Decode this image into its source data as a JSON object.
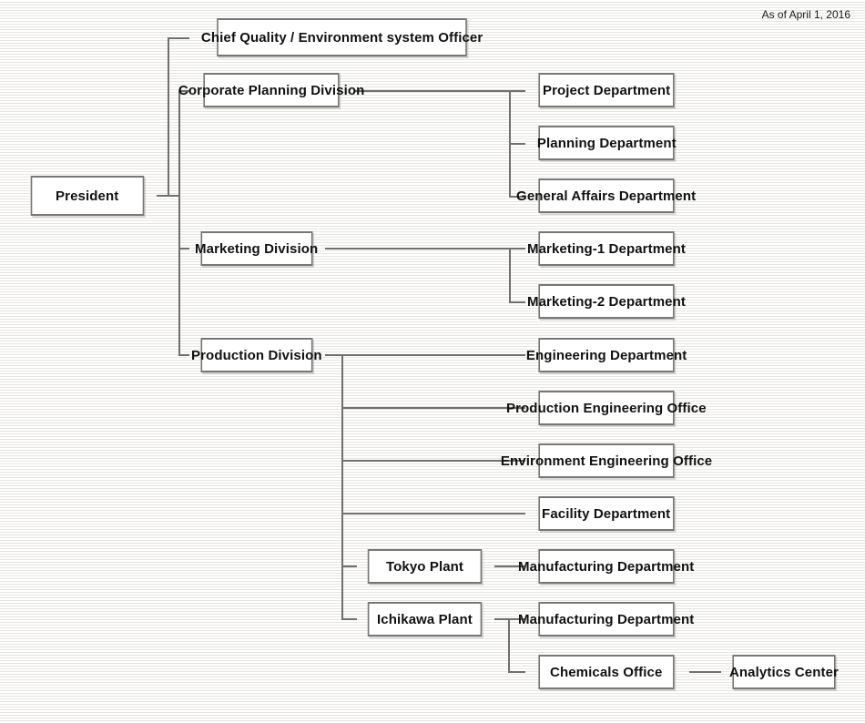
{
  "meta": {
    "as_of": "As of April 1, 2016",
    "diagram_type": "organization-chart",
    "colors": {
      "background": "#fbfbfa",
      "stripe": "#e6e4e0",
      "box_fill": "#ffffff",
      "box_border": "#777777",
      "connector": "#6f6f6f",
      "text": "#111111"
    }
  },
  "nodes": {
    "president": "President",
    "chief_quality_officer": "Chief Quality / Environment system Officer",
    "corporate_planning_division": "Corporate Planning Division",
    "project_department": "Project Department",
    "planning_department": "Planning Department",
    "general_affairs_department": "General Affairs Department",
    "marketing_division": "Marketing Division",
    "marketing_1_department": "Marketing-1 Department",
    "marketing_2_department": "Marketing-2 Department",
    "production_division": "Production Division",
    "engineering_department": "Engineering Department",
    "production_engineering_office": "Production Engineering Office",
    "environment_engineering_office": "Environment Engineering Office",
    "facility_department": "Facility Department",
    "tokyo_plant": "Tokyo Plant",
    "tokyo_manufacturing_department": "Manufacturing Department",
    "ichikawa_plant": "Ichikawa Plant",
    "ichikawa_manufacturing_department": "Manufacturing Department",
    "chemicals_office": "Chemicals Office",
    "analytics_center": "Analytics Center"
  },
  "hierarchy": {
    "root": "President",
    "children": [
      {
        "name": "Chief Quality / Environment system Officer",
        "children": []
      },
      {
        "name": "Corporate Planning Division",
        "children": [
          {
            "name": "Project Department",
            "children": []
          },
          {
            "name": "Planning Department",
            "children": []
          },
          {
            "name": "General Affairs Department",
            "children": []
          }
        ]
      },
      {
        "name": "Marketing Division",
        "children": [
          {
            "name": "Marketing-1 Department",
            "children": []
          },
          {
            "name": "Marketing-2 Department",
            "children": []
          }
        ]
      },
      {
        "name": "Production Division",
        "children": [
          {
            "name": "Engineering Department",
            "children": []
          },
          {
            "name": "Production Engineering Office",
            "children": []
          },
          {
            "name": "Environment Engineering Office",
            "children": []
          },
          {
            "name": "Facility Department",
            "children": []
          },
          {
            "name": "Tokyo Plant",
            "children": [
              {
                "name": "Manufacturing Department",
                "children": []
              }
            ]
          },
          {
            "name": "Ichikawa Plant",
            "children": [
              {
                "name": "Manufacturing Department",
                "children": []
              },
              {
                "name": "Chemicals Office",
                "children": [
                  {
                    "name": "Analytics Center",
                    "children": []
                  }
                ]
              }
            ]
          }
        ]
      }
    ]
  }
}
